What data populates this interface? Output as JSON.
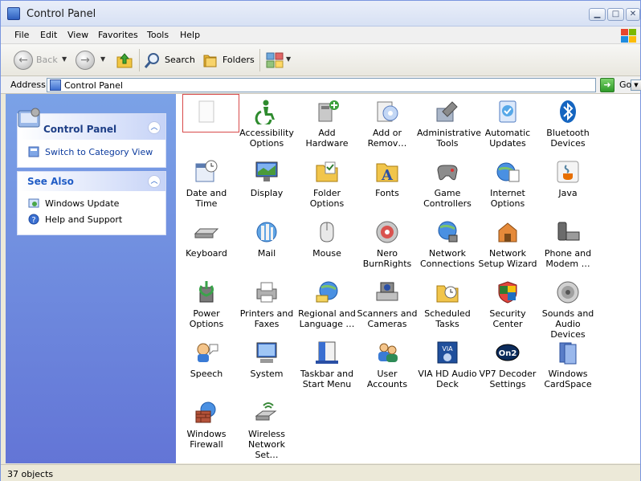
{
  "window": {
    "title": "Control Panel"
  },
  "menu": {
    "items": [
      "File",
      "Edit",
      "View",
      "Favorites",
      "Tools",
      "Help"
    ]
  },
  "toolbar": {
    "back_label": "Back",
    "search_label": "Search",
    "folders_label": "Folders"
  },
  "address": {
    "label": "Address",
    "value": "Control Panel",
    "go_label": "Go"
  },
  "leftpane": {
    "control_panel": {
      "title": "Control Panel",
      "switch_label": "Switch to Category View"
    },
    "see_also": {
      "title": "See Also",
      "items": [
        "Windows Update",
        "Help and Support"
      ]
    }
  },
  "items": [
    {
      "label": "",
      "icon": "blank-page-icon"
    },
    {
      "label": "Accessibility Options",
      "icon": "accessibility-icon"
    },
    {
      "label": "Add Hardware",
      "icon": "add-hardware-icon"
    },
    {
      "label": "Add or Remov…",
      "icon": "add-remove-programs-icon"
    },
    {
      "label": "Administrative Tools",
      "icon": "administrative-tools-icon"
    },
    {
      "label": "Automatic Updates",
      "icon": "automatic-updates-icon"
    },
    {
      "label": "Bluetooth Devices",
      "icon": "bluetooth-icon"
    },
    {
      "label": "Date and Time",
      "icon": "date-time-icon"
    },
    {
      "label": "Display",
      "icon": "display-icon"
    },
    {
      "label": "Folder Options",
      "icon": "folder-options-icon"
    },
    {
      "label": "Fonts",
      "icon": "fonts-icon"
    },
    {
      "label": "Game Controllers",
      "icon": "game-controllers-icon"
    },
    {
      "label": "Internet Options",
      "icon": "internet-options-icon"
    },
    {
      "label": "Java",
      "icon": "java-icon"
    },
    {
      "label": "Keyboard",
      "icon": "keyboard-icon"
    },
    {
      "label": "Mail",
      "icon": "mail-icon"
    },
    {
      "label": "Mouse",
      "icon": "mouse-icon"
    },
    {
      "label": "Nero BurnRights",
      "icon": "nero-icon"
    },
    {
      "label": "Network Connections",
      "icon": "network-connections-icon"
    },
    {
      "label": "Network Setup Wizard",
      "icon": "network-setup-icon"
    },
    {
      "label": "Phone and Modem …",
      "icon": "phone-modem-icon"
    },
    {
      "label": "Power Options",
      "icon": "power-options-icon"
    },
    {
      "label": "Printers and Faxes",
      "icon": "printers-icon"
    },
    {
      "label": "Regional and Language …",
      "icon": "regional-language-icon"
    },
    {
      "label": "Scanners and Cameras",
      "icon": "scanners-cameras-icon"
    },
    {
      "label": "Scheduled Tasks",
      "icon": "scheduled-tasks-icon"
    },
    {
      "label": "Security Center",
      "icon": "security-center-icon"
    },
    {
      "label": "Sounds and Audio Devices",
      "icon": "sounds-audio-icon"
    },
    {
      "label": "Speech",
      "icon": "speech-icon"
    },
    {
      "label": "System",
      "icon": "system-icon"
    },
    {
      "label": "Taskbar and Start Menu",
      "icon": "taskbar-start-menu-icon"
    },
    {
      "label": "User Accounts",
      "icon": "user-accounts-icon"
    },
    {
      "label": "VIA HD Audio Deck",
      "icon": "via-hd-audio-icon"
    },
    {
      "label": "VP7 Decoder Settings",
      "icon": "vp7-decoder-icon"
    },
    {
      "label": "Windows CardSpace",
      "icon": "cardspace-icon"
    },
    {
      "label": "Windows Firewall",
      "icon": "firewall-icon"
    },
    {
      "label": "Wireless Network Set…",
      "icon": "wireless-network-icon"
    }
  ],
  "status": {
    "text": "37 objects"
  },
  "colors": {
    "sidebar_top": "#7ba2e7",
    "sidebar_bottom": "#6375d6",
    "link": "#0c3b9e",
    "selection_border": "#d84a4a"
  }
}
